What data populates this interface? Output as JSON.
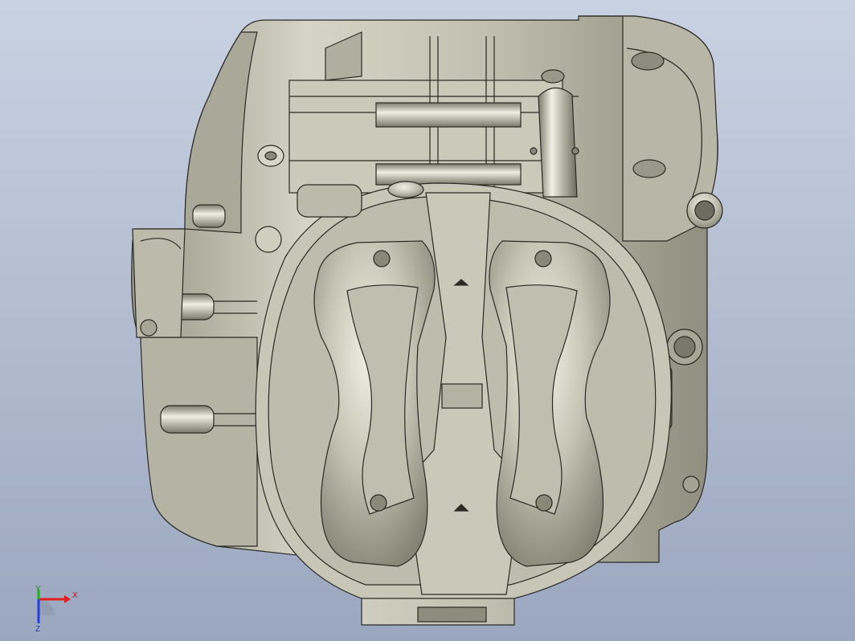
{
  "viewport": {
    "background_top": "#c9d2e2",
    "background_bottom": "#9ba7bf",
    "part_fill": "#c4c2b2",
    "part_dark": "#8a8878",
    "part_light": "#e6e4d6",
    "edge_color": "#2a2a26"
  },
  "triad": {
    "x_label": "X",
    "y_label": "Y",
    "z_label": "Z",
    "x_color": "#e02020",
    "y_color": "#20b020",
    "z_color": "#2040e0"
  }
}
